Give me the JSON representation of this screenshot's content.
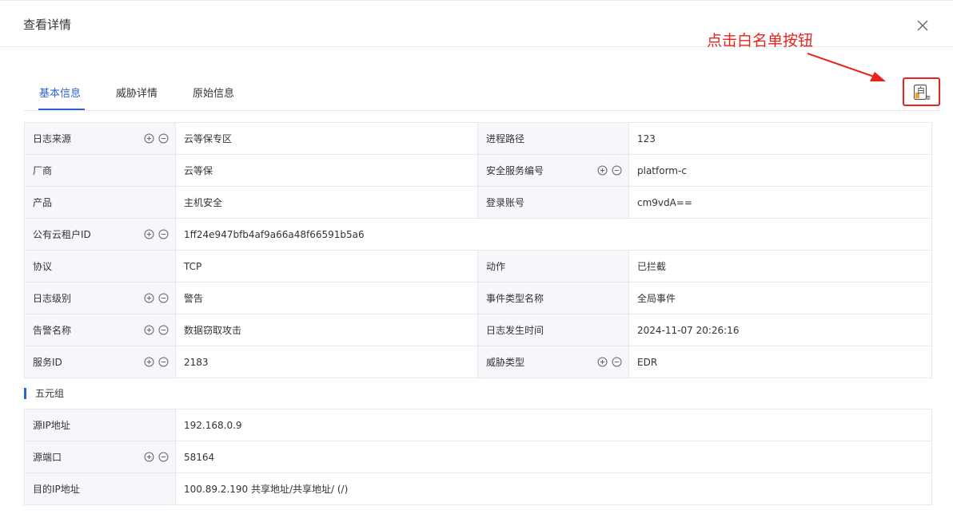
{
  "dialog": {
    "title": "查看详情"
  },
  "annotation": {
    "text": "点击白名单按钮"
  },
  "tabs": [
    {
      "label": "基本信息",
      "active": true
    },
    {
      "label": "威胁详情",
      "active": false
    },
    {
      "label": "原始信息",
      "active": false
    }
  ],
  "whitelist_button": {
    "glyph_main": "白",
    "glyph_sub": "单"
  },
  "basic_info": {
    "rows": [
      {
        "l1": "日志来源",
        "v1": "云等保专区",
        "l2": "进程路径",
        "v2": "123"
      },
      {
        "l1": "厂商",
        "v1": "云等保",
        "l2": "安全服务编号",
        "v2": "platform-c"
      },
      {
        "l1": "产品",
        "v1": "主机安全",
        "l2": "登录账号",
        "v2": "cm9vdA=="
      },
      {
        "l1": "公有云租户ID",
        "v1": "1ff24e947bfb4af9a66a48f66591b5a6"
      },
      {
        "l1": "协议",
        "v1": "TCP",
        "l2": "动作",
        "v2": "已拦截"
      },
      {
        "l1": "日志级别",
        "v1": "警告",
        "l2": "事件类型名称",
        "v2": "全局事件"
      },
      {
        "l1": "告警名称",
        "v1": "数据窃取攻击",
        "l2": "日志发生时间",
        "v2": "2024-11-07 20:26:16"
      },
      {
        "l1": "服务ID",
        "v1": "2183",
        "l2": "威胁类型",
        "v2": "EDR"
      }
    ]
  },
  "five_tuple": {
    "title": "五元组",
    "rows": [
      {
        "label": "源IP地址",
        "value": "192.168.0.9"
      },
      {
        "label": "源端口",
        "value": "58164"
      },
      {
        "label": "目的IP地址",
        "value": "100.89.2.190 共享地址/共享地址/ (/)"
      }
    ]
  },
  "colors": {
    "accent": "#2e63d5",
    "annotation": "#e8231b",
    "label_bg": "#f5f7fb",
    "border": "#e5e8ee"
  }
}
